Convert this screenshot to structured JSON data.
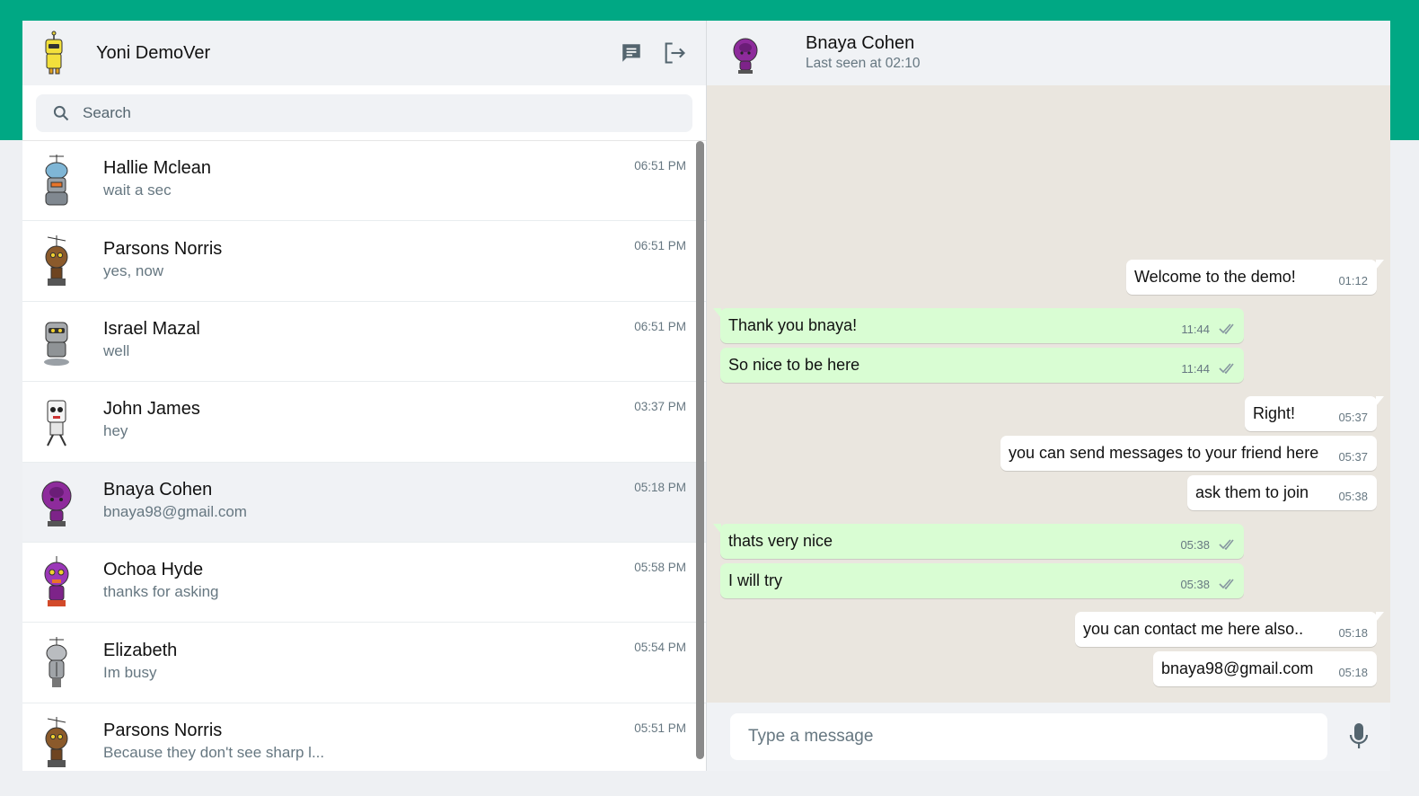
{
  "me": {
    "name": "Yoni DemoVer",
    "avatar_icon": "yellow-robot-avatar"
  },
  "header_icons": {
    "new_chat": "chat-icon",
    "logout": "logout-icon"
  },
  "search": {
    "placeholder": "Search"
  },
  "chats": [
    {
      "name": "Hallie Mclean",
      "last": "wait a sec",
      "time": "06:51 PM",
      "avatar": "grey-robot-orange-mouth",
      "active": false
    },
    {
      "name": "Parsons Norris",
      "last": "yes, now",
      "time": "06:51 PM",
      "avatar": "brown-robot-antenna",
      "active": false
    },
    {
      "name": "Israel Mazal",
      "last": "well",
      "time": "06:51 PM",
      "avatar": "grey-robot-yellow-eyes",
      "active": false
    },
    {
      "name": "John James",
      "last": "hey",
      "time": "03:37 PM",
      "avatar": "white-box-robot",
      "active": false
    },
    {
      "name": "Bnaya Cohen",
      "last": "bnaya98@gmail.com",
      "time": "05:18 PM",
      "avatar": "purple-blob-robot",
      "active": true
    },
    {
      "name": "Ochoa Hyde",
      "last": "thanks for asking",
      "time": "05:58 PM",
      "avatar": "purple-robot-yellow-eyes",
      "active": false
    },
    {
      "name": "Elizabeth",
      "last": "Im busy",
      "time": "05:54 PM",
      "avatar": "grey-robot-antenna",
      "active": false
    },
    {
      "name": "Parsons Norris",
      "last": "Because they don't see sharp l...",
      "time": "05:51 PM",
      "avatar": "brown-robot-antenna",
      "active": false
    }
  ],
  "conversation": {
    "peer_name": "Bnaya Cohen",
    "peer_status": "Last seen at 02:10",
    "messages": [
      {
        "dir": "out",
        "text": "Welcome to the demo!",
        "time": "01:12",
        "tail": true
      },
      {
        "dir": "in",
        "text": "Thank you bnaya!",
        "time": "11:44",
        "read": true,
        "tail": true
      },
      {
        "dir": "in",
        "text": "So nice to be here",
        "time": "11:44",
        "read": true,
        "tail": false
      },
      {
        "dir": "out",
        "text": "Right!",
        "time": "05:37",
        "tail": true
      },
      {
        "dir": "out",
        "text": "you can send messages to your friend here",
        "time": "05:37",
        "tail": false
      },
      {
        "dir": "out",
        "text": "ask them to join",
        "time": "05:38",
        "tail": false
      },
      {
        "dir": "in",
        "text": "thats very nice",
        "time": "05:38",
        "read": true,
        "tail": true
      },
      {
        "dir": "in",
        "text": "I will try",
        "time": "05:38",
        "read": true,
        "tail": false
      },
      {
        "dir": "out",
        "text": "you can contact me here also..",
        "time": "05:18",
        "tail": true
      },
      {
        "dir": "out",
        "text": "bnaya98@gmail.com",
        "time": "05:18",
        "tail": false
      }
    ]
  },
  "composer": {
    "placeholder": "Type a message",
    "mic_icon": "microphone-icon"
  },
  "colors": {
    "brand_green": "#00a884",
    "incoming_bubble": "#d9fdd3",
    "panel_bg": "#f0f2f5",
    "chat_bg": "#eae6df"
  }
}
